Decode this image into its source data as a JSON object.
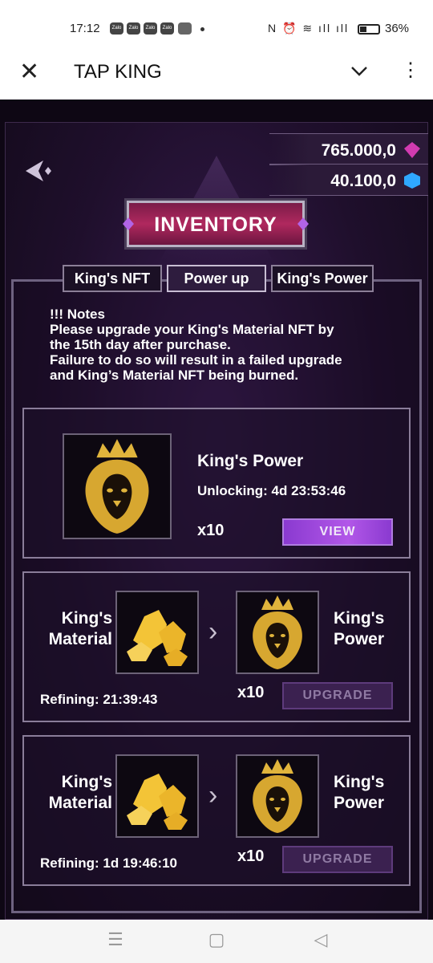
{
  "status_bar": {
    "time": "17:12",
    "notif_icons": [
      "Zalo",
      "Zalo",
      "Zalo",
      "Zalo"
    ],
    "system_icons": "N ⏰ ≋ ıll ıll",
    "battery": "36%"
  },
  "app_bar": {
    "title": "TAP KING"
  },
  "currencies": [
    {
      "value": "765.000,0",
      "icon": "pink-gem-icon",
      "color": "#d13bb0"
    },
    {
      "value": "40.100,0",
      "icon": "blue-gem-icon",
      "color": "#2fa8ff"
    }
  ],
  "banner": {
    "title": "INVENTORY"
  },
  "tabs": [
    {
      "label": "King's NFT"
    },
    {
      "label": "Power up"
    },
    {
      "label": "King's Power"
    }
  ],
  "notes": {
    "heading": "!!! Notes",
    "lines": [
      "Please upgrade your King's Material NFT by",
      "the 15th day after purchase.",
      "Failure to do so will result in a failed upgrade",
      "and King’s Material NFT being burned."
    ]
  },
  "power_card": {
    "name": "King's Power",
    "status": "Unlocking: 4d 23:53:46",
    "qty": "x10",
    "button": "VIEW"
  },
  "refine_cards": [
    {
      "source": [
        "King's",
        "Material"
      ],
      "target": [
        "King's",
        "Power"
      ],
      "qty": "x10",
      "status": "Refining: 21:39:43",
      "button": "UPGRADE"
    },
    {
      "source": [
        "King's",
        "Material"
      ],
      "target": [
        "King's",
        "Power"
      ],
      "qty": "x10",
      "status": "Refining: 1d 19:46:10",
      "button": "UPGRADE"
    }
  ],
  "colors": {
    "accent": "#b257e8",
    "banner": "#b0285e",
    "background": "#1f0f2c"
  }
}
